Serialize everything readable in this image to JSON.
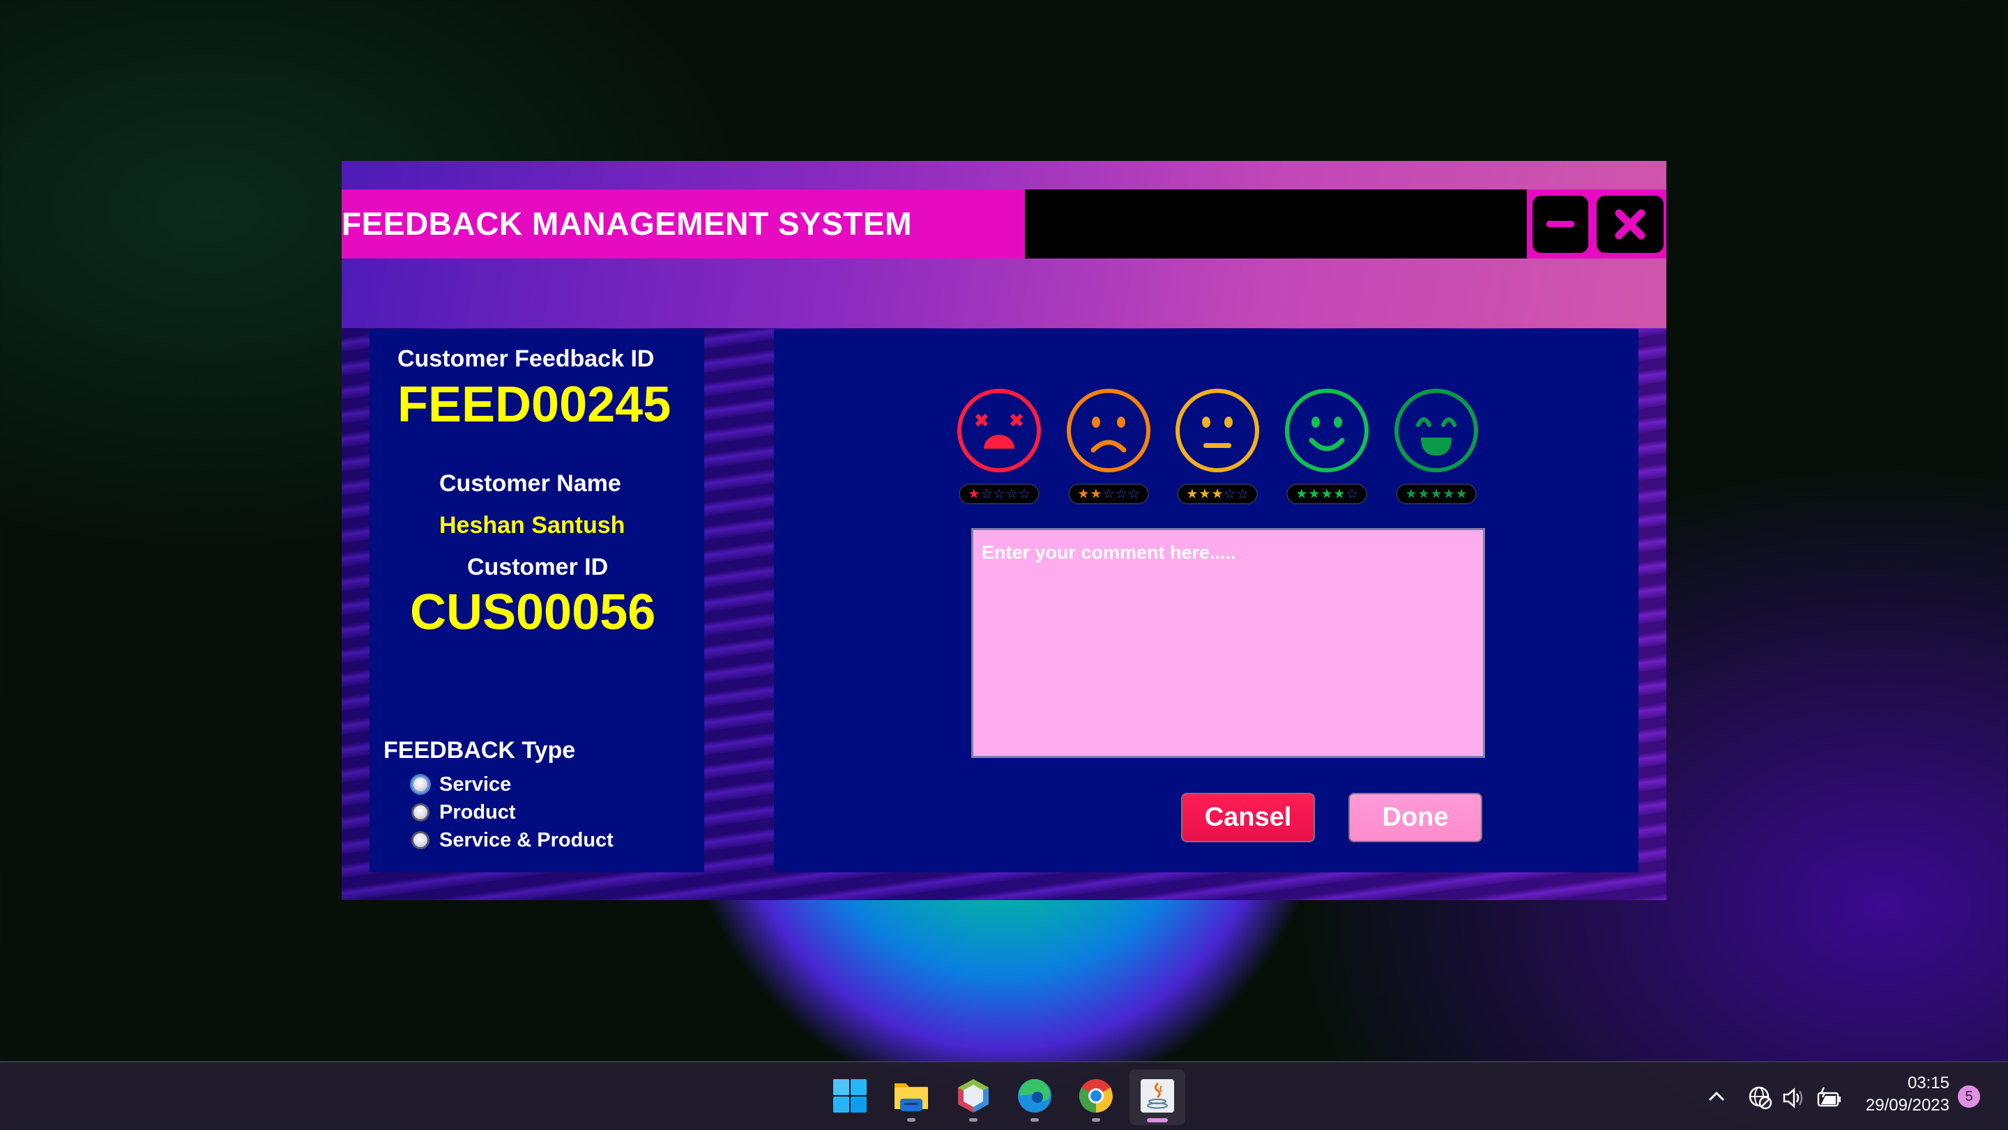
{
  "window": {
    "title": "FEEDBACK MANAGEMENT SYSTEM",
    "minimize_icon": "minus-icon",
    "close_icon": "x-icon"
  },
  "left_panel": {
    "feedback_id_label": "Customer Feedback ID",
    "feedback_id_value": "FEED00245",
    "customer_name_label": "Customer Name",
    "customer_name_value": "Heshan Santush",
    "customer_id_label": "Customer ID",
    "customer_id_value": "CUS00056",
    "feedback_type_label": "FEEDBACK Type",
    "feedback_types": [
      {
        "label": "Service",
        "selected": false,
        "focused": true
      },
      {
        "label": "Product",
        "selected": false,
        "focused": false
      },
      {
        "label": "Service & Product",
        "selected": false,
        "focused": false
      }
    ]
  },
  "rating": {
    "options": [
      {
        "name": "very-bad",
        "icon": "dizzy-face-icon",
        "stars": 1,
        "color": "#ff1e3c"
      },
      {
        "name": "bad",
        "icon": "sad-face-icon",
        "stars": 2,
        "color": "#f5820f"
      },
      {
        "name": "neutral",
        "icon": "neutral-face-icon",
        "stars": 3,
        "color": "#f0b020"
      },
      {
        "name": "good",
        "icon": "smile-face-icon",
        "stars": 4,
        "color": "#10c050"
      },
      {
        "name": "excellent",
        "icon": "laughing-face-icon",
        "stars": 5,
        "color": "#0a9a4a"
      }
    ],
    "max_stars": 5,
    "empty_star_color": "#1a2aa0"
  },
  "comment": {
    "placeholder": "Enter your comment here.....",
    "value": ""
  },
  "buttons": {
    "cancel_label": "Cansel",
    "done_label": "Done"
  },
  "taskbar": {
    "apps": [
      {
        "name": "start",
        "icon": "windows-start-icon",
        "running": false
      },
      {
        "name": "file-explorer",
        "icon": "folder-icon",
        "running": true
      },
      {
        "name": "netbeans",
        "icon": "netbeans-icon",
        "running": true
      },
      {
        "name": "edge",
        "icon": "edge-icon",
        "running": true
      },
      {
        "name": "chrome",
        "icon": "chrome-icon",
        "running": true
      },
      {
        "name": "java",
        "icon": "java-icon",
        "running": true,
        "active": true
      }
    ],
    "time": "03:15",
    "date": "29/09/2023",
    "notification_count": "5"
  },
  "colors": {
    "title_pink": "#e60ac0",
    "panel_navy": "#000c80",
    "value_yellow": "#ffff00",
    "comment_bg": "#ffacef",
    "cancel_red": "#f01450",
    "done_pink": "#ff94d2"
  }
}
